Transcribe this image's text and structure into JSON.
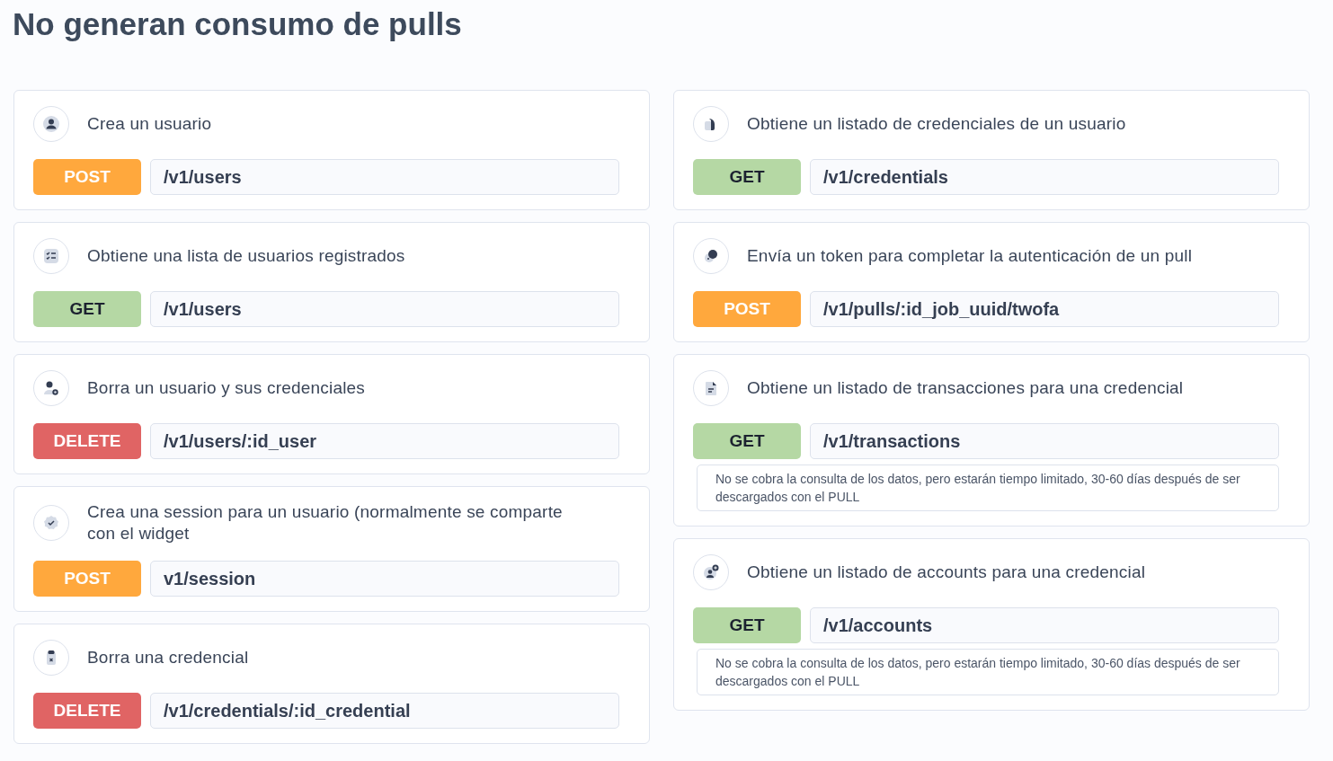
{
  "title": "No generan consumo de pulls",
  "columns": [
    {
      "cards": [
        {
          "description": "Crea un usuario",
          "kind": "post",
          "method": "POST",
          "path": "/v1/users"
        },
        {
          "description": "Obtiene una lista de usuarios registrados",
          "kind": "get",
          "method": "GET",
          "path": "/v1/users"
        },
        {
          "description": "Borra un usuario y sus credenciales",
          "kind": "delete",
          "method": "DELETE",
          "path": "/v1/users/:id_user"
        },
        {
          "description": "Crea una session para un usuario (normalmente se comparte con el widget",
          "kind": "post",
          "method": "POST",
          "path": "v1/session"
        },
        {
          "description": "Borra una credencial",
          "kind": "delete",
          "method": "DELETE",
          "path": "/v1/credentials/:id_credential"
        }
      ]
    },
    {
      "cards": [
        {
          "description": "Obtiene un listado de credenciales de un usuario",
          "kind": "get",
          "method": "GET",
          "path": "/v1/credentials"
        },
        {
          "description": "Envía un token para completar la autenticación de un pull",
          "kind": "post",
          "method": "POST",
          "path": "/v1/pulls/:id_job_uuid/twofa"
        },
        {
          "description": "Obtiene un listado de transacciones para una credencial",
          "kind": "get",
          "method": "GET",
          "path": "/v1/transactions",
          "note": "No se cobra la consulta de los datos, pero estarán tiempo limitado, 30-60 días después de ser descargados con el PULL"
        },
        {
          "description": "Obtiene un listado de accounts para una credencial",
          "kind": "get",
          "method": "GET",
          "path": "/v1/accounts",
          "note": "No se cobra la consulta de los datos, pero estarán tiempo limitado, 30-60 días después de ser descargados con el PULL"
        }
      ]
    }
  ]
}
